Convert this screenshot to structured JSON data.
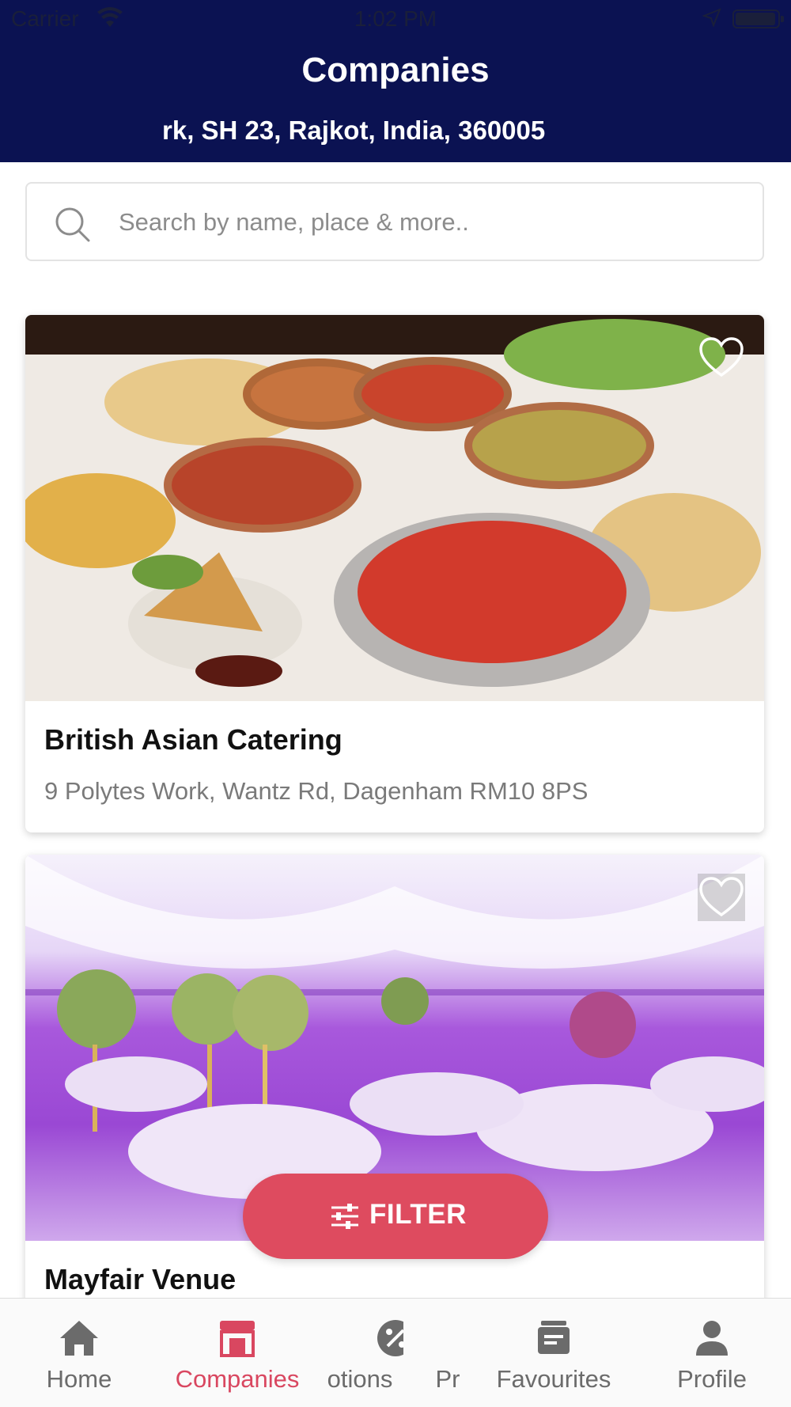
{
  "status_bar": {
    "carrier": "Carrier",
    "time": "1:02 PM"
  },
  "header": {
    "title": "Companies",
    "location": "rk, SH 23, Rajkot, India, 360005"
  },
  "search": {
    "placeholder": "Search by name, place & more.."
  },
  "companies": [
    {
      "name": "British Asian Catering",
      "address": "9 Polytes Work, Wantz Rd, Dagenham RM10 8PS",
      "favourite": false
    },
    {
      "name": "Mayfair Venue",
      "favourite": false
    }
  ],
  "filter_button": {
    "label": "FILTER"
  },
  "tabs": [
    {
      "label": "Home",
      "icon": "home-icon"
    },
    {
      "label": "Companies",
      "icon": "store-icon",
      "active": true
    },
    {
      "label": "otions",
      "icon": "discount-badge-icon"
    },
    {
      "label": "Pr",
      "icon": ""
    },
    {
      "label": "Favourites",
      "icon": "favourites-icon"
    },
    {
      "label": "Profile",
      "icon": "profile-icon"
    }
  ],
  "colors": {
    "header": "#0b1252",
    "accent": "#de4b5f",
    "tab_active": "#d94760",
    "tab_inactive": "#6b6b6b"
  }
}
